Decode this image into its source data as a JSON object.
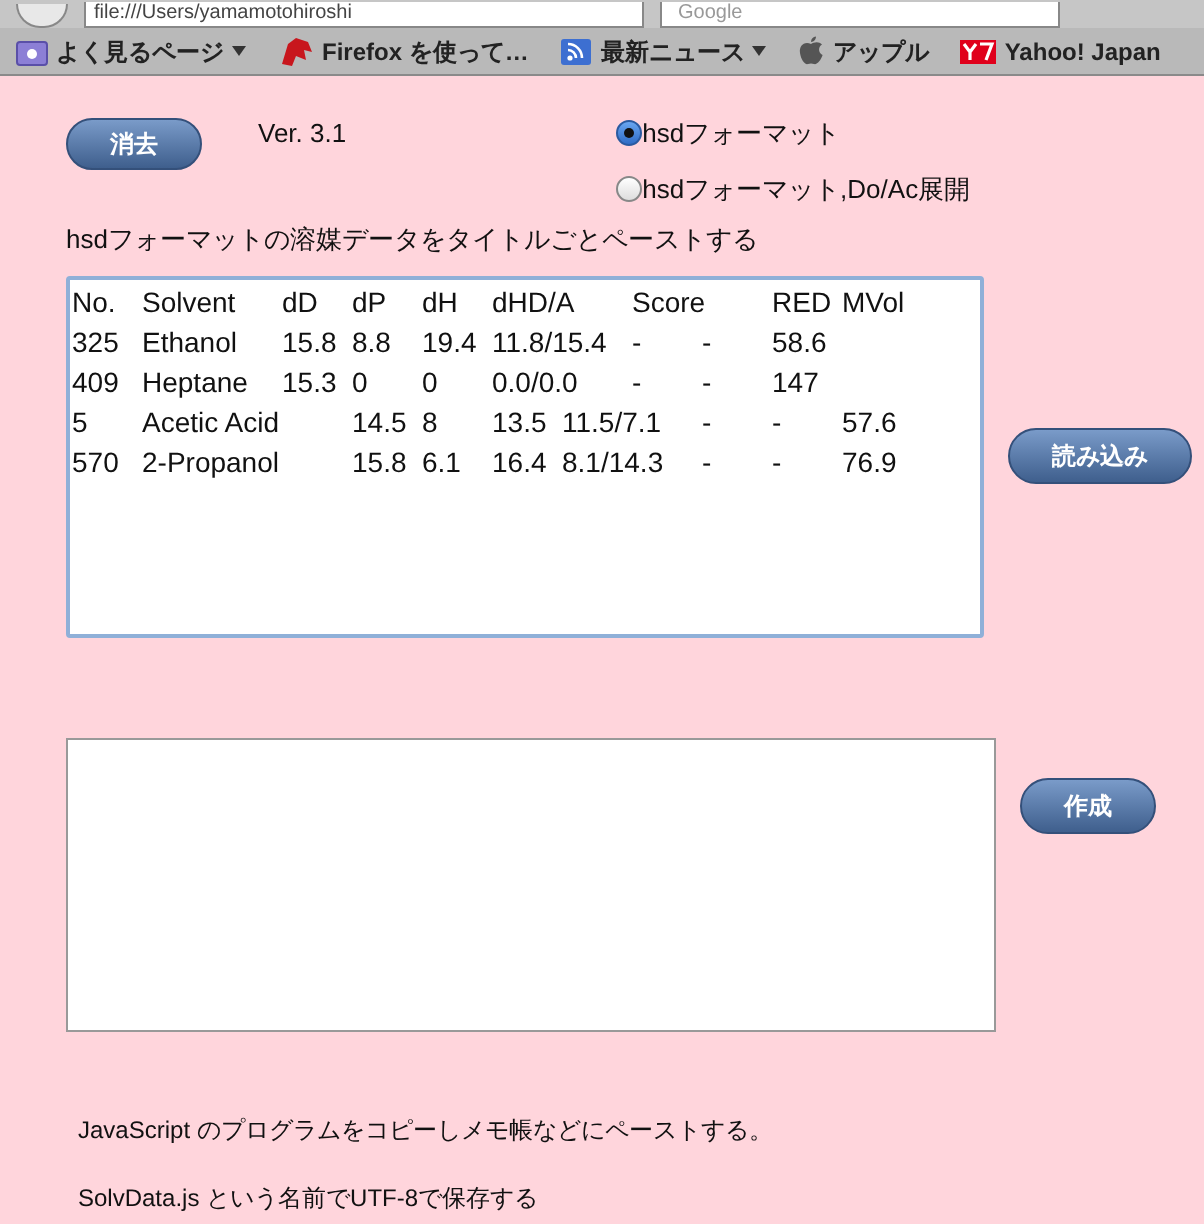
{
  "browser": {
    "url": "file:///Users/yamamotohiroshi",
    "search_placeholder": "Google"
  },
  "bookmarks": [
    {
      "label": "よく見るページ",
      "menu": true,
      "kind": "folder"
    },
    {
      "label": "Firefox を使って…",
      "menu": false,
      "kind": "firefox"
    },
    {
      "label": "最新ニュース",
      "menu": true,
      "kind": "rss"
    },
    {
      "label": "アップル",
      "menu": false,
      "kind": "apple"
    },
    {
      "label": "Yahoo! Japan",
      "menu": false,
      "kind": "yahoo"
    }
  ],
  "clear_button": "消去",
  "version": "Ver. 3.1",
  "formats": [
    {
      "label": "hsdフォーマット",
      "selected": true
    },
    {
      "label": "hsdフォーマット,Do/Ac展開",
      "selected": false
    }
  ],
  "input_instruction": "hsdフォーマットの溶媒データをタイトルごとペーストする",
  "input_lines": [
    "No.\tSolvent\tdD\tdP\tdH\tdHD/A\tScore\tRED\tMVol",
    "325\tEthanol\t15.8\t8.8\t19.4\t11.8/15.4\t-\t-\t58.6",
    "409\tHeptane\t15.3\t0\t0\t0.0/0.0\t-\t-\t147",
    "5\tAcetic Acid\t14.5\t8\t13.5\t11.5/7.1\t-\t-\t57.6",
    "570\t2-Propanol\t15.8\t6.1\t16.4\t8.1/14.3\t-\t-\t76.9"
  ],
  "load_button": "読み込み",
  "create_button": "作成",
  "notes": [
    "JavaScript のプログラムをコピーしメモ帳などにペーストする。",
    "SolvData.js という名前でUTF-8で保存する"
  ]
}
